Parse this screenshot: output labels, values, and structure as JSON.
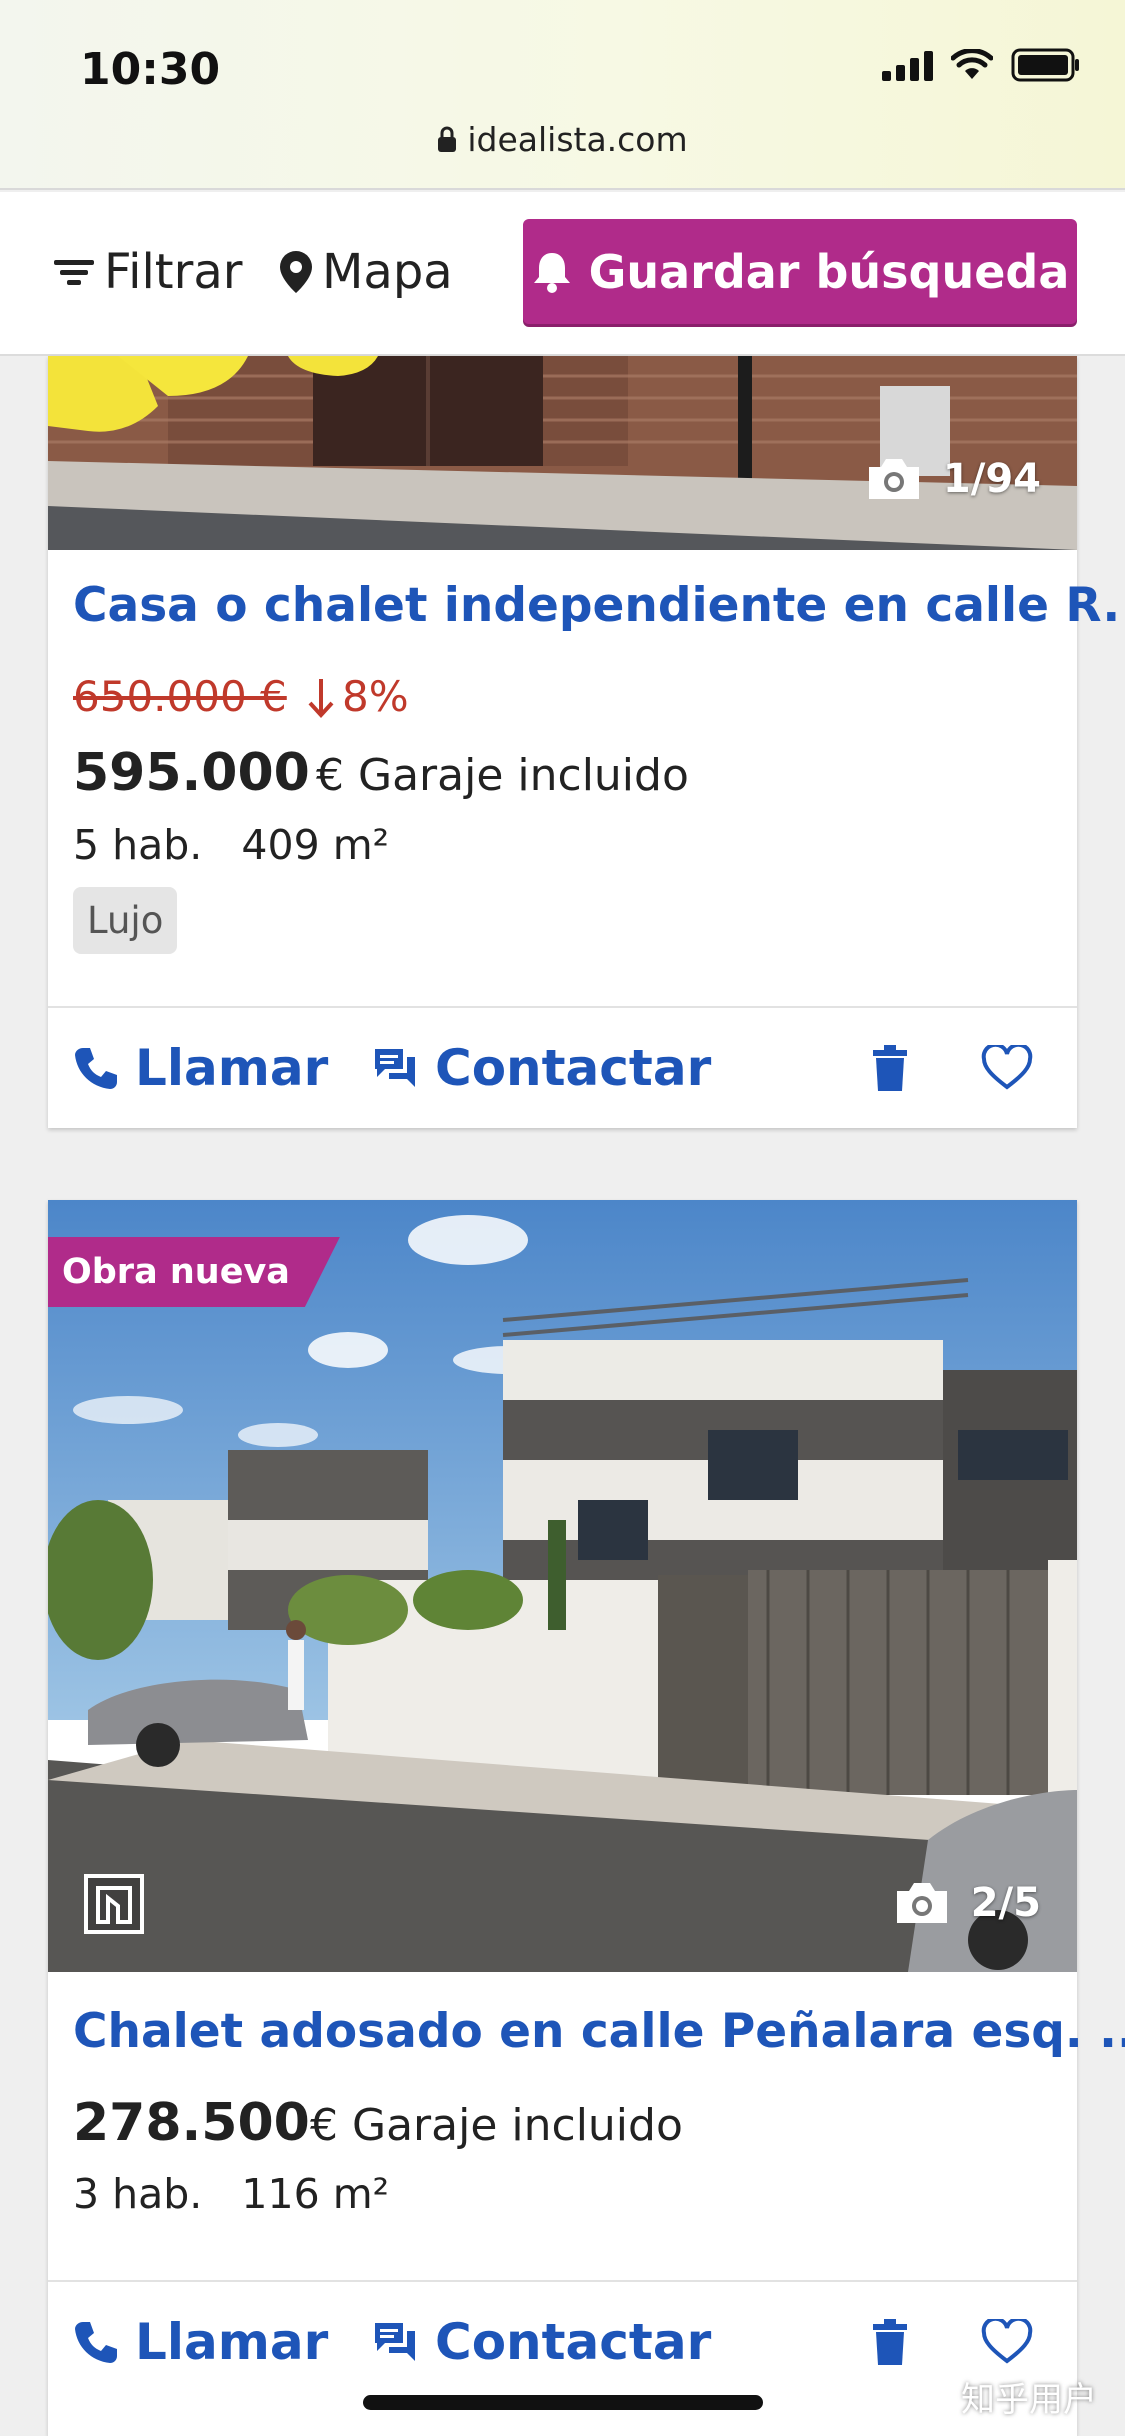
{
  "status_bar": {
    "time": "10:30"
  },
  "url_bar": {
    "domain": "idealista.com"
  },
  "toolbar": {
    "filter_label": "Filtrar",
    "map_label": "Mapa",
    "save_search_label": "Guardar búsqueda"
  },
  "listings": [
    {
      "photo_counter": "1/94",
      "title": "Casa o chalet independiente en calle R...",
      "old_price": "650.000 €",
      "price_drop": "8%",
      "price": "595.000",
      "currency": "€",
      "price_note": "Garaje incluido",
      "rooms": "5 hab.",
      "area": "409 m²",
      "tag": "Lujo",
      "actions": {
        "call": "Llamar",
        "contact": "Contactar"
      }
    },
    {
      "badge": "Obra nueva",
      "photo_counter": "2/5",
      "title": "Chalet adosado en calle Peñalara esq. ...",
      "price": "278.500",
      "currency": "€",
      "price_note": "Garaje incluido",
      "rooms": "3 hab.",
      "area": "116 m²",
      "actions": {
        "call": "Llamar",
        "contact": "Contactar"
      }
    }
  ],
  "watermark": "知乎用户",
  "colors": {
    "brand": "#b02b8a",
    "link": "#1e55b8",
    "price_drop": "#c0392b"
  }
}
